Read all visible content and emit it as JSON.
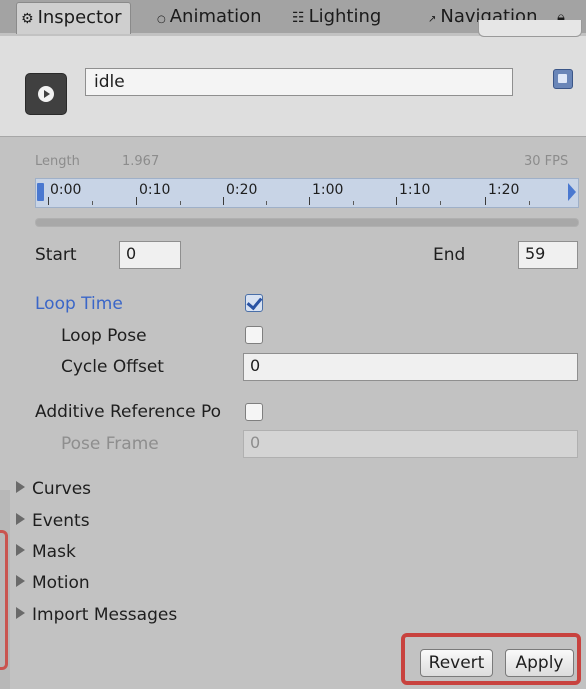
{
  "tabs": [
    {
      "label": "Inspector",
      "icon": "info-icon",
      "active": true
    },
    {
      "label": "Animation",
      "icon": "animation-icon",
      "active": false
    },
    {
      "label": "Lighting",
      "icon": "lighting-icon",
      "active": false
    },
    {
      "label": "Navigation",
      "icon": "navigation-icon",
      "active": false
    }
  ],
  "header": {
    "clip_name": "idle",
    "icons": {
      "play": "play-circle-icon",
      "help": "help-book-icon",
      "lock": "lock-icon"
    }
  },
  "clip": {
    "length_label": "Length",
    "length_value": "1.967",
    "fps": "30 FPS"
  },
  "timeline": {
    "labels": [
      "0:00",
      "0:10",
      "0:20",
      "1:00",
      "1:10",
      "1:20"
    ]
  },
  "range": {
    "start_label": "Start",
    "start_value": "0",
    "end_label": "End",
    "end_value": "59"
  },
  "loop": {
    "loop_time_label": "Loop Time",
    "loop_time_checked": true,
    "loop_pose_label": "Loop Pose",
    "loop_pose_checked": false,
    "cycle_offset_label": "Cycle Offset",
    "cycle_offset_value": "0"
  },
  "additive": {
    "label": "Additive Reference Po",
    "checked": false,
    "pose_frame_label": "Pose Frame",
    "pose_frame_value": "0"
  },
  "foldouts": [
    "Curves",
    "Events",
    "Mask",
    "Motion",
    "Import Messages"
  ],
  "buttons": {
    "revert": "Revert",
    "apply": "Apply"
  },
  "colors": {
    "loop_time_label": "#3a66c8",
    "highlight": "#c8423e",
    "timeline_bg": "#c8d4e6"
  }
}
